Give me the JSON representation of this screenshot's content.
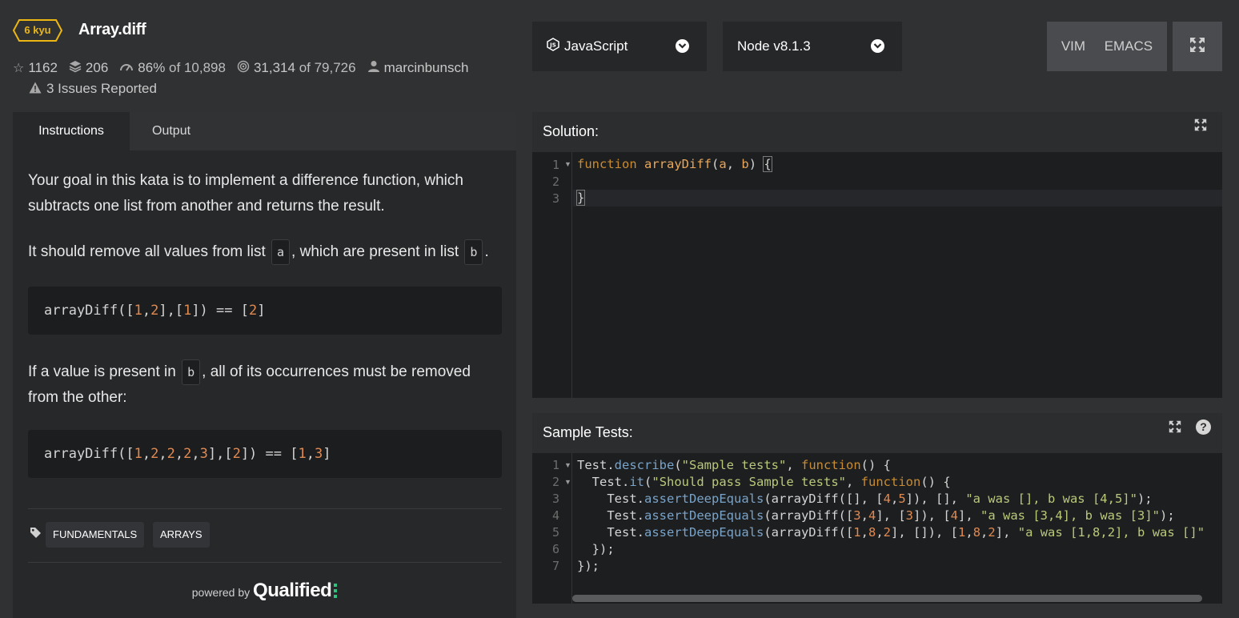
{
  "kata": {
    "rank": "6 kyu",
    "title": "Array.diff",
    "stars": "1162",
    "collections": "206",
    "satisfaction": "86%",
    "satisfaction_of": "of 10,898",
    "completed": "31,314",
    "completed_of": "of 79,726",
    "author": "marcinbunsch",
    "issues": "3 Issues Reported",
    "accent_color": "#ecb613"
  },
  "toolbar": {
    "language": "JavaScript",
    "runtime": "Node v8.1.3",
    "keymap_vim": "VIM",
    "keymap_emacs": "EMACS"
  },
  "tabs": [
    {
      "label": "Instructions",
      "active": true
    },
    {
      "label": "Output",
      "active": false
    }
  ],
  "instructions": {
    "p1": "Your goal in this kata is to implement a difference function, which subtracts one list from another and returns the result.",
    "p2_pre": "It should remove all values from list",
    "p2_code_a": "a",
    "p2_mid": ", which are present in list",
    "p2_code_b": "b",
    "p2_post": ".",
    "example1": {
      "pre": "arrayDiff([",
      "n1": "1",
      "c1": ",",
      "n2": "2",
      "mid": "],[",
      "n3": "1",
      "post": "]) == [",
      "n4": "2",
      "end": "]"
    },
    "p3_pre": "If a value is present in",
    "p3_code": "b",
    "p3_post": ", all of its occurrences must be removed from the other:",
    "example2": {
      "pre": "arrayDiff([",
      "n1": "1",
      "n2": "2",
      "n3": "2",
      "n4": "2",
      "n5": "3",
      "mid": "],[",
      "n6": "2",
      "post": "]) == [",
      "n7": "1",
      "n8": "3",
      "end": "]"
    }
  },
  "tags": [
    "FUNDAMENTALS",
    "ARRAYS"
  ],
  "powered_by": {
    "prefix": "powered by",
    "brand": "Qualified"
  },
  "solution": {
    "title": "Solution:",
    "line_numbers": [
      "1",
      "2",
      "3"
    ],
    "l1_kw": "function",
    "l1_fn": "arrayDiff",
    "l1_open": "(",
    "l1_a": "a",
    "l1_comma": ", ",
    "l1_b": "b",
    "l1_close": ") ",
    "l1_brace": "{",
    "l3_brace": "}"
  },
  "sample_tests": {
    "title": "Sample Tests:",
    "help": "?",
    "line_numbers": [
      "1",
      "2",
      "3",
      "4",
      "5",
      "6",
      "7"
    ],
    "lines": [
      {
        "indent": "",
        "obj": "Test",
        "dot": ".",
        "method": "describe",
        "open": "(",
        "str": "\"Sample tests\"",
        "comma": ", ",
        "kw": "function",
        "rest": "() {"
      },
      {
        "indent": "  ",
        "obj": "Test",
        "dot": ".",
        "method": "it",
        "open": "(",
        "str": "\"Should pass Sample tests\"",
        "comma": ", ",
        "kw": "function",
        "rest": "() {"
      },
      {
        "indent": "    ",
        "obj": "Test",
        "dot": ".",
        "method": "assertDeepEquals",
        "call": "(arrayDiff([], [",
        "n": [
          "4",
          "5"
        ],
        "mid": "]), [], ",
        "str": "\"a was [], b was [4,5]\"",
        "end": ");"
      },
      {
        "indent": "    ",
        "obj": "Test",
        "dot": ".",
        "method": "assertDeepEquals",
        "call": "(arrayDiff([",
        "str": "\"a was [3,4], b was [3]\"",
        "end": ");"
      },
      {
        "indent": "    ",
        "obj": "Test",
        "dot": ".",
        "method": "assertDeepEquals",
        "call": "(arrayDiff([",
        "str": "\"a was [1,8,2], b was []\"",
        "end": ""
      },
      {
        "text": "  });"
      },
      {
        "text": "});"
      }
    ]
  }
}
